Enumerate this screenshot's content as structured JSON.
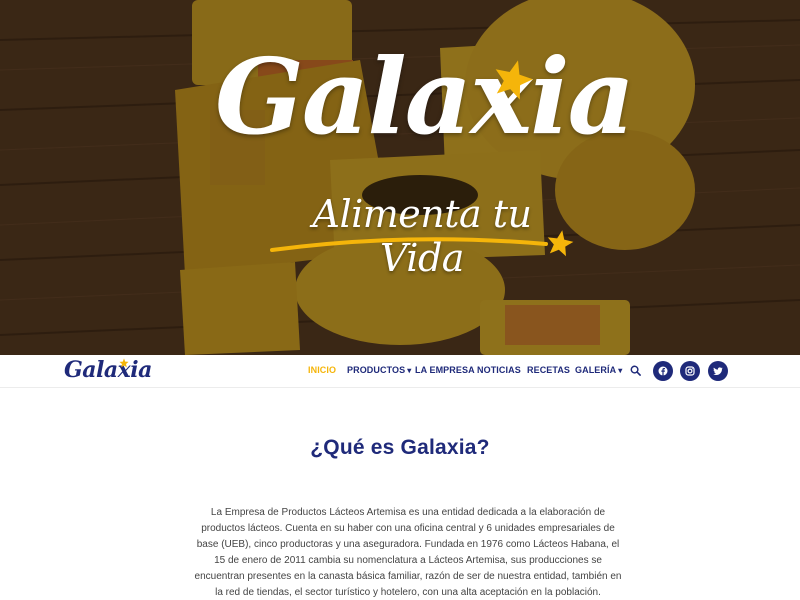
{
  "hero": {
    "logo_text": "Galaxia",
    "tagline": "Alimenta tu Vida"
  },
  "navbar": {
    "logo_text": "Galaxia",
    "items": [
      {
        "label": "INICIO",
        "active": true,
        "dropdown": false
      },
      {
        "label": "PRODUCTOS",
        "active": false,
        "dropdown": true
      },
      {
        "label": "LA EMPRESA",
        "active": false,
        "dropdown": false
      },
      {
        "label": "NOTICIAS",
        "active": false,
        "dropdown": false
      },
      {
        "label": "RECETAS",
        "active": false,
        "dropdown": false
      },
      {
        "label": "GALERÍA",
        "active": false,
        "dropdown": true
      }
    ],
    "search_icon": "search-icon",
    "social": [
      "facebook-icon",
      "instagram-icon",
      "twitter-icon"
    ]
  },
  "about": {
    "title": "¿Qué es Galaxia?",
    "body": "La Empresa de Productos Lácteos Artemisa es una entidad dedicada a la elaboración de productos lácteos. Cuenta en su haber con una oficina central y 6 unidades empresariales de base (UEB), cinco productoras y una aseguradora. Fundada en 1976 como Lácteos Habana, el 15 de enero de 2011 cambia su nomenclatura a Lácteos Artemisa, sus producciones se encuentran presentes en la canasta básica familiar, razón de ser de nuestra entidad, también en la red de tiendas, el sector turístico y hotelero, con una alta aceptación en la población."
  },
  "colors": {
    "brand_navy": "#1f2a7a",
    "brand_yellow": "#f5b50a",
    "cheese_yellow": "#e8b828",
    "wood_brown": "#5a3e24"
  }
}
